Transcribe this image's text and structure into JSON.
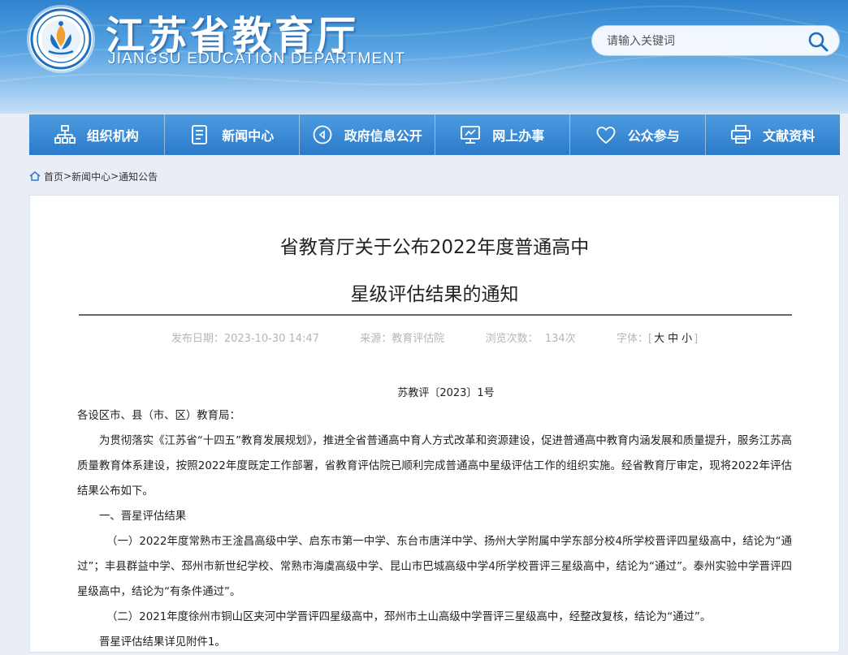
{
  "header": {
    "title": "江苏省教育厅",
    "subtitle": "JIANGSU EDUCATION DEPARTMENT",
    "search_placeholder": "请输入关键词"
  },
  "nav": {
    "items": [
      {
        "label": "组织机构",
        "icon": "org-chart-icon"
      },
      {
        "label": "新闻中心",
        "icon": "news-document-icon"
      },
      {
        "label": "政府信息公开",
        "icon": "info-disclosure-icon"
      },
      {
        "label": "网上办事",
        "icon": "monitor-icon"
      },
      {
        "label": "公众参与",
        "icon": "heart-icon"
      },
      {
        "label": "文献资料",
        "icon": "printer-icon"
      }
    ]
  },
  "breadcrumb": {
    "home": "首页",
    "sep1": ">",
    "news": "新闻中心",
    "sep2": ">",
    "notices": "通知公告"
  },
  "article": {
    "title_line1": "省教育厅关于公布2022年度普通高中",
    "title_line2": "星级评估结果的通知",
    "meta": {
      "date_label": "发布日期：",
      "date_value": "2023-10-30 14:47",
      "source_label": "来源：",
      "source_value": "教育评估院",
      "views_label": "浏览次数：",
      "views_value": "134次",
      "font_label": "字体：",
      "bracket_open": "[",
      "size_large": "大",
      "size_medium": "中",
      "size_small": "小",
      "bracket_close": "]"
    },
    "doc_number": "苏教评〔2023〕1号",
    "paragraphs": [
      "各设区市、县（市、区）教育局：",
      "为贯彻落实《江苏省“十四五”教育发展规划》，推进全省普通高中育人方式改革和资源建设，促进普通高中教育内涵发展和质量提升，服务江苏高质量教育体系建设，按照2022年度既定工作部署，省教育评估院已顺利完成普通高中星级评估工作的组织实施。经省教育厅审定，现将2022年评估结果公布如下。",
      "一、晋星评估结果",
      "（一）2022年度常熟市王淦昌高级中学、启东市第一中学、东台市唐洋中学、扬州大学附属中学东部分校4所学校晋评四星级高中，结论为“通过”；丰县群益中学、邳州市新世纪学校、常熟市海虞高级中学、昆山市巴城高级中学4所学校晋评三星级高中，结论为“通过”。泰州实验中学晋评四星级高中，结论为“有条件通过”。",
      "（二）2021年度徐州市铜山区夹河中学晋评四星级高中，邳州市土山高级中学晋评三星级高中，经整改复核，结论为“通过”。",
      "晋星评估结果详见附件1。"
    ]
  },
  "colors": {
    "nav_bg": "#3a8ad6",
    "header_top": "#2f83cf",
    "meta_text": "#b5b5b5"
  }
}
